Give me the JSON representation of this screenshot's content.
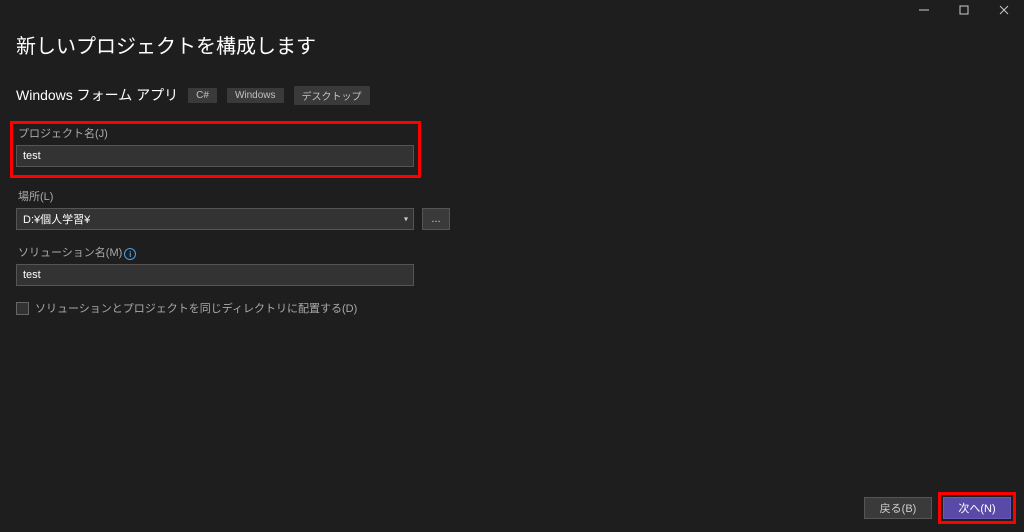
{
  "titleBar": {
    "windowControls": {
      "minimize": "minimize",
      "maximize": "maximize",
      "close": "close"
    }
  },
  "header": {
    "title": "新しいプロジェクトを構成します"
  },
  "template": {
    "name": "Windows フォーム アプリ",
    "tags": [
      "C#",
      "Windows",
      "デスクトップ"
    ]
  },
  "fields": {
    "projectName": {
      "label": "プロジェクト名(J)",
      "value": "test"
    },
    "location": {
      "label": "場所(L)",
      "value": "D:¥個人学習¥",
      "browse": "..."
    },
    "solutionName": {
      "label": "ソリューション名(M)",
      "value": "test"
    },
    "sameDir": {
      "label": "ソリューションとプロジェクトを同じディレクトリに配置する(D)"
    }
  },
  "footer": {
    "back": "戻る(B)",
    "next": "次へ(N)"
  }
}
